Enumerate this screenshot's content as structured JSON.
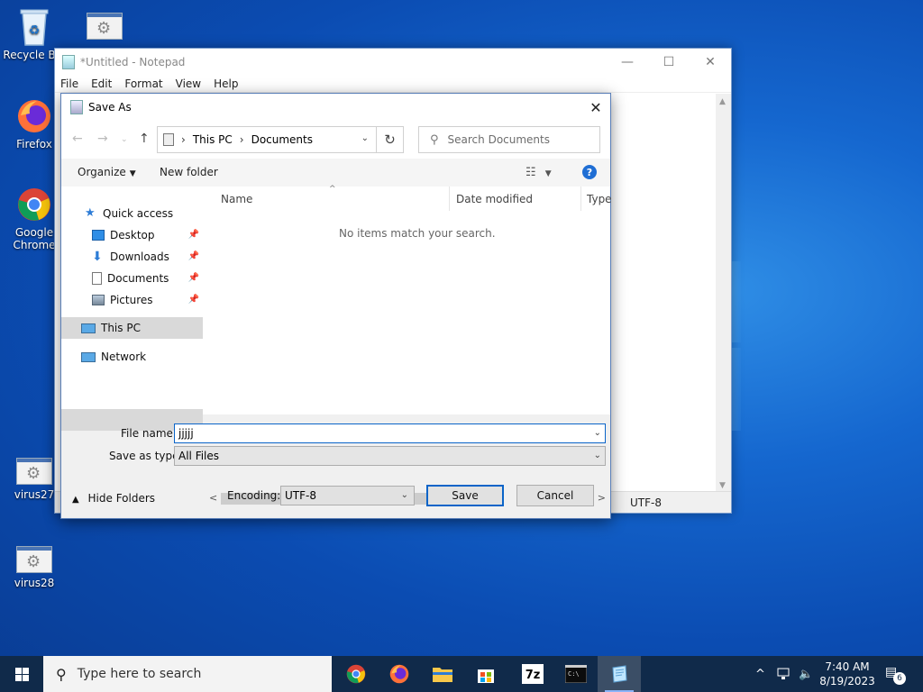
{
  "desktop": {
    "icons": [
      {
        "label": "Recycle Bin"
      },
      {
        "label": ""
      },
      {
        "label": "Firefox"
      },
      {
        "label": "Google Chrome"
      },
      {
        "label": "virus27"
      },
      {
        "label": "virus28"
      }
    ]
  },
  "notepad": {
    "title": "*Untitled - Notepad",
    "menu": [
      "File",
      "Edit",
      "Format",
      "View",
      "Help"
    ],
    "status_encoding": "UTF-8"
  },
  "dialog": {
    "title": "Save As",
    "address": {
      "root": "This PC",
      "folder": "Documents"
    },
    "search_placeholder": "Search Documents",
    "toolbar": {
      "organize": "Organize",
      "new_folder": "New folder"
    },
    "nav_tree": [
      {
        "label": "Quick access"
      },
      {
        "label": "Desktop",
        "pinned": true
      },
      {
        "label": "Downloads",
        "pinned": true
      },
      {
        "label": "Documents",
        "pinned": true
      },
      {
        "label": "Pictures",
        "pinned": true
      },
      {
        "label": "This PC",
        "selected": true
      },
      {
        "label": "Network"
      }
    ],
    "columns": [
      "Name",
      "Date modified",
      "Type"
    ],
    "empty_message": "No items match your search.",
    "file_name_label": "File name:",
    "file_name_value": "jjjjj",
    "save_type_label": "Save as type:",
    "save_type_value": "All Files",
    "hide_folders": "Hide Folders",
    "encoding_label": "Encoding:",
    "encoding_value": "UTF-8",
    "save_button": "Save",
    "cancel_button": "Cancel"
  },
  "taskbar": {
    "search_placeholder": "Type here to search",
    "time": "7:40 AM",
    "date": "8/19/2023",
    "notification_count": "6"
  }
}
